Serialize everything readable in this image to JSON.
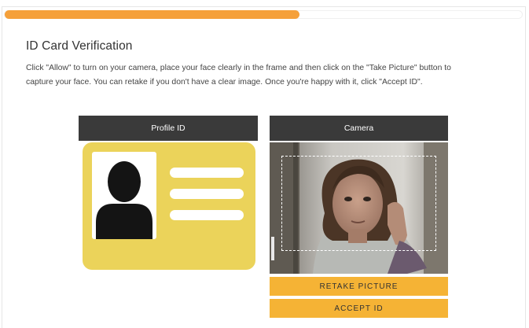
{
  "progress": {
    "fraction": 0.57,
    "color": "#f5a03a"
  },
  "page": {
    "title": "ID Card Verification",
    "instructions_line1": "Click \"Allow\" to turn on your camera, place your face clearly in the frame and then click on the \"Take Picture\" button to",
    "instructions_line2": "capture your face. You can retake if you don't have a clear image. Once you're happy with it, click \"Accept ID\"."
  },
  "profile_panel": {
    "header": "Profile ID",
    "card_color": "#ebd35a",
    "icon": "person-silhouette-icon"
  },
  "camera_panel": {
    "header": "Camera",
    "frame_style": "dashed-white"
  },
  "buttons": {
    "retake_label": "RETAKE PICTURE",
    "accept_label": "ACCEPT ID",
    "color": "#f5b335"
  }
}
